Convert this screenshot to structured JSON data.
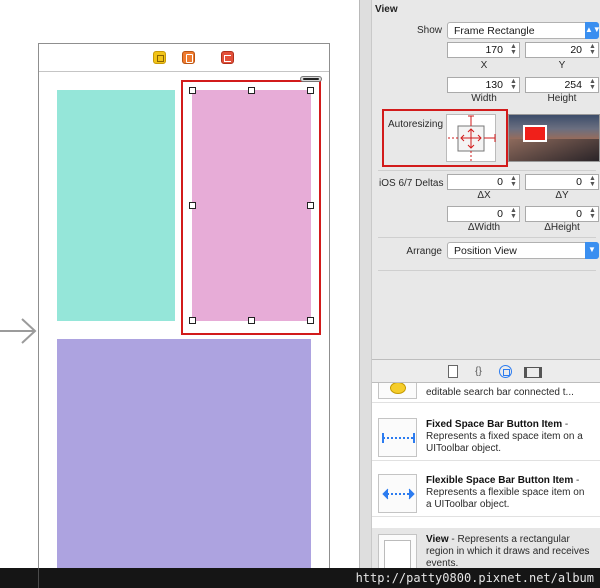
{
  "inspector": {
    "section_title": "View",
    "show_label": "Show",
    "show_value": "Frame Rectangle",
    "x_value": "170",
    "x_label": "X",
    "y_value": "20",
    "y_label": "Y",
    "width_value": "130",
    "width_label": "Width",
    "height_value": "254",
    "height_label": "Height",
    "autoresizing_label": "Autoresizing",
    "ios_deltas_label": "iOS 6/7 Deltas",
    "dx_value": "0",
    "dx_label": "ΔX",
    "dy_value": "0",
    "dy_label": "ΔY",
    "dwidth_value": "0",
    "dwidth_label": "ΔWidth",
    "dheight_value": "0",
    "dheight_label": "ΔHeight",
    "arrange_label": "Arrange",
    "arrange_value": "Position View"
  },
  "library": {
    "items": [
      {
        "title": "",
        "description": "editable search bar connected t..."
      },
      {
        "title": "Fixed Space Bar Button Item",
        "description": " - Represents a fixed space item on a UIToolbar object."
      },
      {
        "title": "Flexible Space Bar Button Item",
        "description": " - Represents a flexible space item on a UIToolbar object."
      },
      {
        "title": "View",
        "description": " - Represents a rectangular region in which it draws and receives events."
      }
    ]
  },
  "watermark": "http://patty0800.pixnet.net/album",
  "colors": {
    "teal_view": "#95e6d9",
    "pink_view": "#e7acd7",
    "purple_view": "#ada3e0",
    "highlight_red": "#d21b1b",
    "accent_blue": "#3a8ff0"
  },
  "icons": {
    "dock": [
      "view-controller-icon",
      "first-responder-icon",
      "exit-icon"
    ],
    "library_tabs": [
      "file-template-icon",
      "code-snippet-icon",
      "object-library-icon",
      "media-library-icon"
    ]
  }
}
